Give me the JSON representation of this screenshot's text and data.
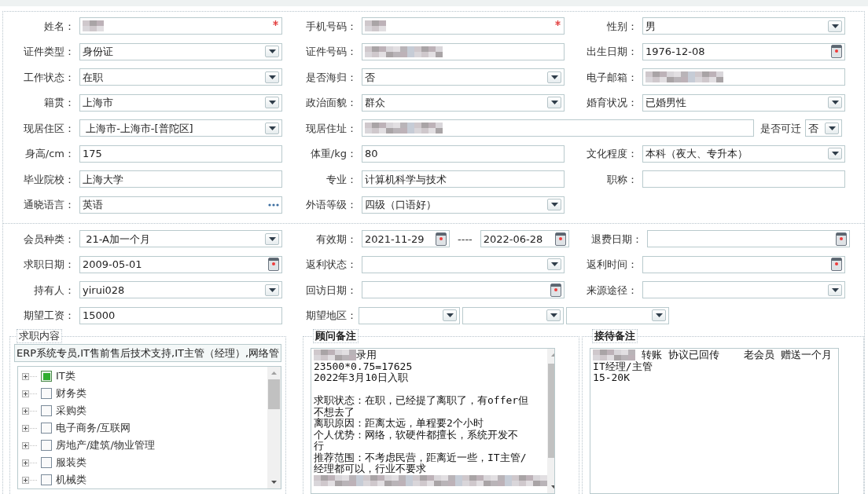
{
  "sections": [
    {
      "rows": [
        {
          "cells": [
            {
              "kind": "normal",
              "label": "姓名：",
              "controls": [
                {
                  "kind": "text",
                  "redacted": true,
                  "required": true
                }
              ]
            },
            {
              "kind": "normal",
              "label": "手机号码：",
              "controls": [
                {
                  "kind": "text",
                  "redacted": true,
                  "required": true
                }
              ]
            },
            {
              "kind": "normal",
              "label": "性别：",
              "controls": [
                {
                  "kind": "select",
                  "value": "男"
                }
              ]
            }
          ]
        },
        {
          "cells": [
            {
              "kind": "normal",
              "label": "证件类型：",
              "controls": [
                {
                  "kind": "select",
                  "value": "身份证"
                }
              ]
            },
            {
              "kind": "normal",
              "label": "证件号码：",
              "controls": [
                {
                  "kind": "text",
                  "redacted": true
                }
              ]
            },
            {
              "kind": "normal",
              "label": "出生日期：",
              "controls": [
                {
                  "kind": "date",
                  "value": "1976-12-08"
                }
              ]
            }
          ]
        },
        {
          "cells": [
            {
              "kind": "normal",
              "label": "工作状态：",
              "controls": [
                {
                  "kind": "select",
                  "value": "在职"
                }
              ]
            },
            {
              "kind": "normal",
              "label": "是否海归：",
              "controls": [
                {
                  "kind": "select",
                  "value": "否"
                }
              ]
            },
            {
              "kind": "normal",
              "label": "电子邮箱：",
              "controls": [
                {
                  "kind": "text",
                  "redacted": true
                }
              ]
            }
          ]
        },
        {
          "cells": [
            {
              "kind": "normal",
              "label": "籍贯：",
              "controls": [
                {
                  "kind": "select",
                  "value": "上海市"
                }
              ]
            },
            {
              "kind": "normal",
              "label": "政治面貌：",
              "controls": [
                {
                  "kind": "select",
                  "value": "群众"
                }
              ]
            },
            {
              "kind": "normal",
              "label": "婚育状况：",
              "controls": [
                {
                  "kind": "select",
                  "value": "已婚男性"
                }
              ]
            }
          ]
        },
        {
          "cells": [
            {
              "kind": "normal",
              "label": "现居住区：",
              "controls": [
                {
                  "kind": "select",
                  "value": " 上海市-上海市-[普陀区]"
                }
              ]
            },
            {
              "kind": "wide",
              "label": "现居住址：",
              "controls": [
                {
                  "kind": "text",
                  "redacted": true
                },
                {
                  "kind": "label",
                  "value": "是否可迁"
                },
                {
                  "kind": "select",
                  "value": "否"
                }
              ]
            }
          ]
        },
        {
          "cells": [
            {
              "kind": "normal",
              "label": "身高/cm：",
              "controls": [
                {
                  "kind": "text",
                  "value": "175"
                }
              ]
            },
            {
              "kind": "normal",
              "label": "体重/kg：",
              "controls": [
                {
                  "kind": "text",
                  "value": "80"
                }
              ]
            },
            {
              "kind": "normal",
              "label": "文化程度：",
              "controls": [
                {
                  "kind": "select",
                  "value": "本科（夜大、专升本）"
                }
              ]
            }
          ]
        },
        {
          "cells": [
            {
              "kind": "normal",
              "label": "毕业院校：",
              "controls": [
                {
                  "kind": "text",
                  "value": "上海大学"
                }
              ]
            },
            {
              "kind": "normal",
              "label": "专业：",
              "controls": [
                {
                  "kind": "text",
                  "value": "计算机科学与技术"
                }
              ]
            },
            {
              "kind": "normal",
              "label": "职称：",
              "controls": [
                {
                  "kind": "text"
                }
              ]
            }
          ]
        },
        {
          "cells": [
            {
              "kind": "normal",
              "label": "通晓语言：",
              "controls": [
                {
                  "kind": "picker",
                  "value": "英语"
                }
              ]
            },
            {
              "kind": "normal",
              "label": "外语等级：",
              "controls": [
                {
                  "kind": "select",
                  "value": "四级（口语好）"
                }
              ]
            }
          ]
        }
      ]
    },
    {
      "rows": [
        {
          "cells": [
            {
              "kind": "normal",
              "label": "会员种类：",
              "controls": [
                {
                  "kind": "select",
                  "value": " 21-A加一个月"
                }
              ]
            },
            {
              "kind": "range",
              "label": "有效期：",
              "controls": [
                {
                  "kind": "date",
                  "value": "2021-11-29"
                },
                {
                  "kind": "dash",
                  "value": "----"
                },
                {
                  "kind": "date",
                  "value": "2022-06-28"
                }
              ]
            },
            {
              "kind": "normal",
              "label": "退费日期：",
              "controls": [
                {
                  "kind": "date"
                }
              ]
            }
          ]
        },
        {
          "cells": [
            {
              "kind": "normal",
              "label": "求职日期：",
              "controls": [
                {
                  "kind": "date",
                  "value": "2009-05-01"
                }
              ]
            },
            {
              "kind": "normal",
              "label": "返利状态：",
              "controls": [
                {
                  "kind": "select"
                }
              ]
            },
            {
              "kind": "normal",
              "label": "返利时间：",
              "controls": [
                {
                  "kind": "date"
                }
              ]
            }
          ]
        },
        {
          "cells": [
            {
              "kind": "normal",
              "label": "持有人：",
              "controls": [
                {
                  "kind": "select",
                  "value": "yirui028"
                }
              ]
            },
            {
              "kind": "normal",
              "label": "回访日期：",
              "controls": [
                {
                  "kind": "date"
                }
              ]
            },
            {
              "kind": "normal",
              "label": "来源途径：",
              "controls": [
                {
                  "kind": "select"
                }
              ]
            }
          ]
        },
        {
          "cells": [
            {
              "kind": "normal",
              "label": "期望工资：",
              "controls": [
                {
                  "kind": "text",
                  "value": "15000"
                }
              ]
            },
            {
              "kind": "multi",
              "label": "期望地区：",
              "controls": [
                {
                  "kind": "select"
                },
                {
                  "kind": "select"
                },
                {
                  "kind": "select"
                }
              ]
            }
          ]
        }
      ]
    }
  ],
  "job_content": {
    "legend": "求职内容",
    "input": "ERP系统专员,IT售前售后技术支持,IT主管（经理）,网络管",
    "tree": [
      {
        "label": "IT类",
        "checked": true
      },
      {
        "label": "财务类",
        "checked": false
      },
      {
        "label": "采购类",
        "checked": false
      },
      {
        "label": "电子商务/互联网",
        "checked": false
      },
      {
        "label": "房地产/建筑/物业管理",
        "checked": false
      },
      {
        "label": "服装类",
        "checked": false
      },
      {
        "label": "机械类",
        "checked": false
      }
    ]
  },
  "notes": [
    {
      "kind": "scrolling",
      "legend": "顾问备注",
      "lines": [
        {
          "kind": "masked",
          "text": "录用"
        },
        {
          "kind": "text",
          "text": "23500*0.75=17625"
        },
        {
          "kind": "text",
          "text": "2022年3月10日入职"
        },
        {
          "kind": "blank"
        },
        {
          "kind": "text",
          "text": "求职状态：在职，已经提了离职了，有offer但"
        },
        {
          "kind": "text",
          "text": "不想去了"
        },
        {
          "kind": "text",
          "text": "离职原因：距离太远，单程要2个小时"
        },
        {
          "kind": "text",
          "text": "个人优势：网络，软硬件都擅长，系统开发不"
        },
        {
          "kind": "text",
          "text": "行"
        },
        {
          "kind": "text",
          "text": "推荐范围：不考虑民营，距离近一些，IT主管/"
        },
        {
          "kind": "text",
          "text": "经理都可以，行业不要求"
        },
        {
          "kind": "hidden"
        }
      ]
    },
    {
      "kind": "plain",
      "legend": "接待备注",
      "lines": [
        {
          "kind": "masked",
          "text": " 转账 协议已回传    老会员 赠送一个月"
        },
        {
          "kind": "text",
          "text": "IT经理/主管"
        },
        {
          "kind": "text",
          "text": "15-20K"
        }
      ]
    }
  ]
}
